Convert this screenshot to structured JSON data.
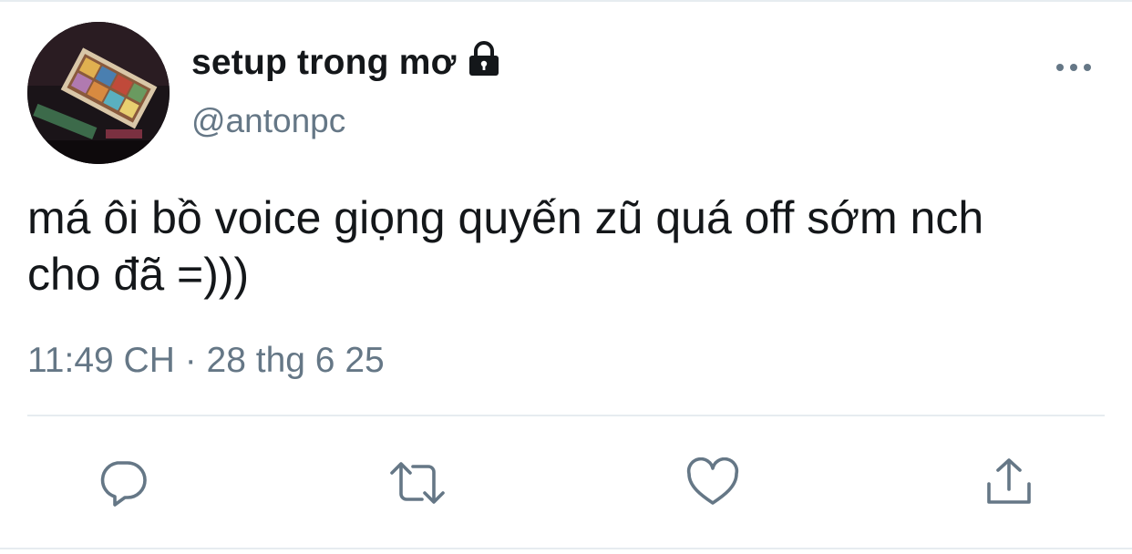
{
  "tweet": {
    "display_name": "setup trong mơ",
    "handle": "@antonpc",
    "text_line1": "má ôi bồ voice giọng quyến zũ quá off sớm nch",
    "text_line2": "cho đã =)))",
    "timestamp": "11:49 CH · 28 thg 6 25",
    "protected_icon": "lock-icon",
    "more_icon": "more-dots-icon"
  },
  "actions": [
    {
      "name": "reply",
      "icon": "reply-icon"
    },
    {
      "name": "retweet",
      "icon": "retweet-icon"
    },
    {
      "name": "like",
      "icon": "heart-icon"
    },
    {
      "name": "share",
      "icon": "share-icon"
    }
  ],
  "colors": {
    "text": "#14171a",
    "secondary": "#657786",
    "divider": "#e6ecf0"
  }
}
